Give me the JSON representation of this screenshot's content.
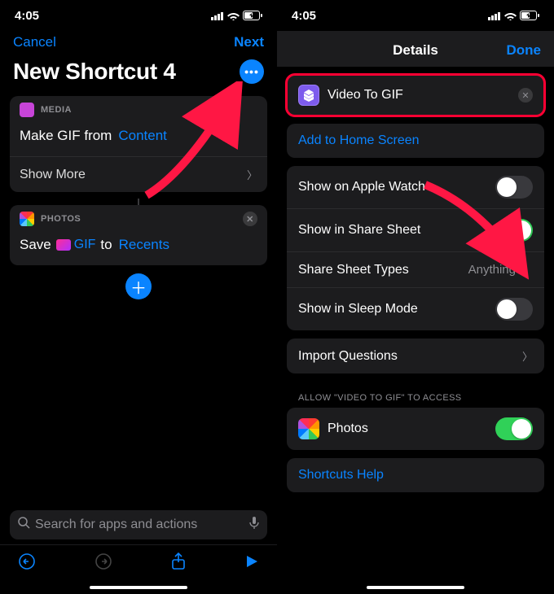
{
  "left": {
    "status": {
      "time": "4:05"
    },
    "nav": {
      "cancel": "Cancel",
      "next": "Next"
    },
    "title": "New Shortcut 4",
    "cards": [
      {
        "category": "MEDIA",
        "line_prefix": "Make GIF from",
        "token": "Content",
        "show_more": "Show More",
        "icon_color": "#c744d8"
      },
      {
        "category": "PHOTOS",
        "line_prefix": "Save",
        "gif_label": "GIF",
        "line_mid": "to",
        "token": "Recents"
      }
    ],
    "search_placeholder": "Search for apps and actions"
  },
  "right": {
    "status": {
      "time": "4:05"
    },
    "nav": {
      "title": "Details",
      "done": "Done"
    },
    "shortcut_name": "Video To GIF",
    "rows": {
      "add_home": "Add to Home Screen",
      "apple_watch": {
        "label": "Show on Apple Watch",
        "on": false
      },
      "share_sheet": {
        "label": "Show in Share Sheet",
        "on": true
      },
      "share_types": {
        "label": "Share Sheet Types",
        "value": "Anything"
      },
      "sleep_mode": {
        "label": "Show in Sleep Mode",
        "on": false
      },
      "import_q": "Import Questions",
      "access_header": "ALLOW \"VIDEO TO GIF\" TO ACCESS",
      "photos": {
        "label": "Photos",
        "on": true
      },
      "help": "Shortcuts Help"
    }
  }
}
